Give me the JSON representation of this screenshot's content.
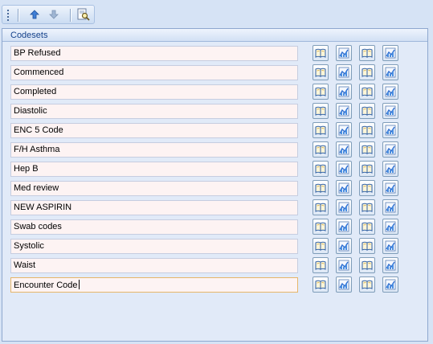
{
  "panel": {
    "title": "Codesets"
  },
  "toolbar": {
    "items": [
      "grip-icon",
      "arrow-up-icon",
      "arrow-down-icon",
      "search-document-icon"
    ]
  },
  "codesets": [
    {
      "value": "BP Refused"
    },
    {
      "value": "Commenced"
    },
    {
      "value": "Completed"
    },
    {
      "value": "Diastolic"
    },
    {
      "value": "ENC 5 Code"
    },
    {
      "value": "F/H Asthma"
    },
    {
      "value": "Hep B"
    },
    {
      "value": "Med review"
    },
    {
      "value": "NEW ASPIRIN"
    },
    {
      "value": "Swab codes"
    },
    {
      "value": "Systolic"
    },
    {
      "value": "Waist"
    },
    {
      "value": "Encounter Code",
      "focused": true
    }
  ],
  "row_buttons": [
    "book-icon",
    "chart-arrow-icon",
    "book-icon",
    "chart-arrow-icon"
  ],
  "colors": {
    "background": "#d6e3f5",
    "panel": "#e1eaf8",
    "title": "#15428b",
    "input_bg": "#fdf3f3",
    "focus_border": "#e6b66a"
  }
}
